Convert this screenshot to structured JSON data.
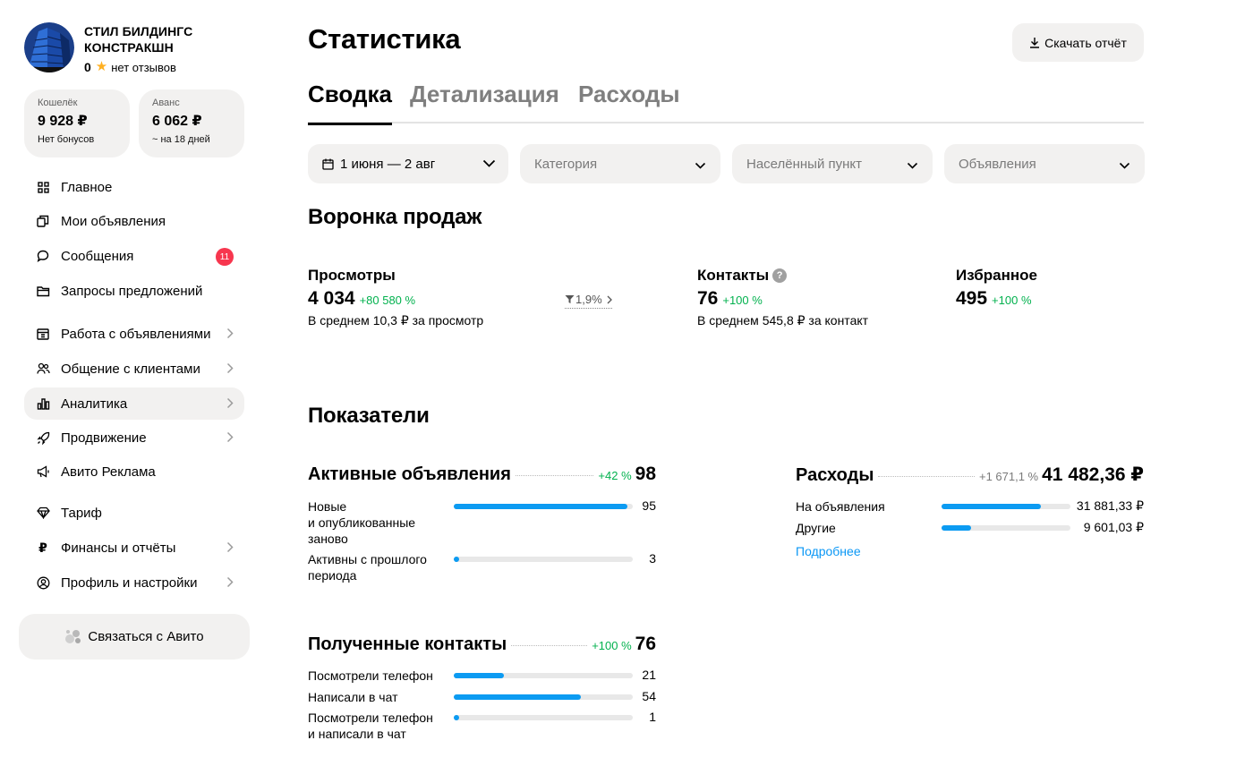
{
  "colors": {
    "accent_blue": "#0c9bf2",
    "positive_green": "#02b14e",
    "badge_red": "#f7364e",
    "surface": "#f2f1f0"
  },
  "company": {
    "name": "СТИЛ БИЛДИНГС КОНСТРАКШН",
    "rating": "0",
    "reviews": "нет отзывов"
  },
  "wallet": {
    "label": "Кошелёк",
    "value": "9 928 ₽",
    "sub": "Нет бонусов"
  },
  "advance": {
    "label": "Аванс",
    "value": "6 062 ₽",
    "sub": "~ на 18 дней"
  },
  "nav": [
    {
      "label": "Главное",
      "icon": "grid-icon"
    },
    {
      "label": "Мои объявления",
      "icon": "ads-icon"
    },
    {
      "label": "Сообщения",
      "icon": "chat-icon",
      "badge": "11"
    },
    {
      "label": "Запросы предложений",
      "icon": "folder-icon"
    },
    {
      "label": "Работа с объявлениями",
      "icon": "calendar-icon"
    },
    {
      "label": "Общение с клиентами",
      "icon": "people-icon"
    },
    {
      "label": "Аналитика",
      "icon": "bar-chart-icon",
      "active": true
    },
    {
      "label": "Продвижение",
      "icon": "rocket-icon"
    },
    {
      "label": "Авито Реклама",
      "icon": "megaphone-icon"
    },
    {
      "label": "Тариф",
      "icon": "diamond-icon"
    },
    {
      "label": "Финансы и отчёты",
      "icon": "ruble-icon"
    },
    {
      "label": "Профиль и настройки",
      "icon": "user-circle-icon"
    }
  ],
  "contact_avito": "Связаться с Авито",
  "page": {
    "title": "Статистика",
    "download": "Скачать отчёт"
  },
  "tabs": [
    "Сводка",
    "Детализация",
    "Расходы"
  ],
  "filters": {
    "period": "1 июня — 2 авг",
    "category": "Категория",
    "city": "Населённый пункт",
    "ads": "Объявления"
  },
  "funnel": {
    "title": "Воронка продаж",
    "views": {
      "label": "Просмотры",
      "value": "4 034",
      "change": "+80 580 %",
      "desc": "В среднем 10,3 ₽ за просмотр"
    },
    "conversion": "1,9%",
    "contacts": {
      "label": "Контакты",
      "value": "76",
      "change": "+100 %",
      "desc": "В среднем 545,8 ₽ за контакт"
    },
    "favorites": {
      "label": "Избранное",
      "value": "495",
      "change": "+100 %"
    }
  },
  "indicators": {
    "title": "Показатели",
    "active_ads": {
      "title": "Активные объявления",
      "change": "+42 %",
      "total": "98",
      "rows": [
        {
          "label": "Новые\nи опубликованные\nзаново",
          "value": "95",
          "fraction": 0.97
        },
        {
          "label": "Активны с прошлого\nпериода",
          "value": "3",
          "fraction": 0.03
        }
      ]
    },
    "expenses": {
      "title": "Расходы",
      "change": "+1 671,1 %",
      "total": "41 482,36 ₽",
      "rows": [
        {
          "label": "На объявления",
          "value": "31 881,33 ₽",
          "fraction": 0.77
        },
        {
          "label": "Другие",
          "value": "9 601,03 ₽",
          "fraction": 0.23
        }
      ],
      "link": "Подробнее"
    },
    "contacts": {
      "title": "Полученные контакты",
      "change": "+100 %",
      "total": "76",
      "rows": [
        {
          "label": "Посмотрели телефон",
          "value": "21",
          "fraction": 0.28
        },
        {
          "label": "Написали в чат",
          "value": "54",
          "fraction": 0.71
        },
        {
          "label": "Посмотрели телефон\nи написали в чат",
          "value": "1",
          "fraction": 0.02
        }
      ]
    }
  }
}
